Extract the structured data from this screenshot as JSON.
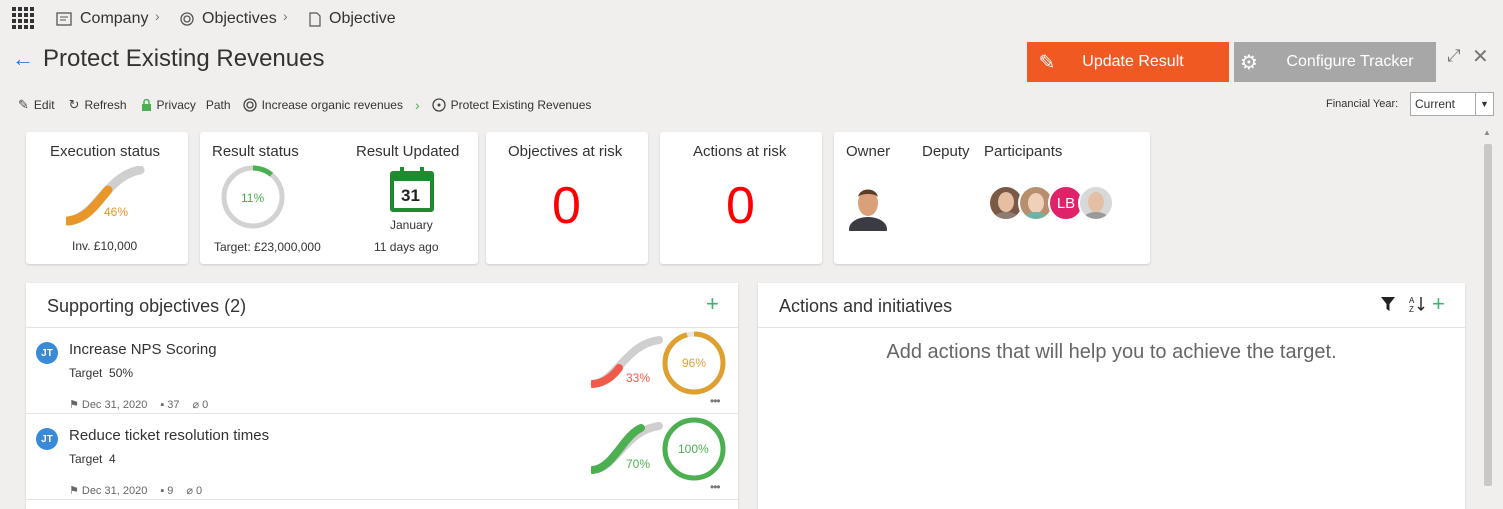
{
  "breadcrumb": {
    "items": [
      {
        "label": "Company",
        "icon": "company-icon"
      },
      {
        "label": "Objectives",
        "icon": "target-icon"
      },
      {
        "label": "Objective",
        "icon": "document-icon"
      }
    ]
  },
  "page": {
    "title": "Protect Existing Revenues"
  },
  "actions": {
    "update_label": "Update Result",
    "configure_label": "Configure Tracker"
  },
  "toolbar": {
    "edit_label": "Edit",
    "refresh_label": "Refresh",
    "privacy_label": "Privacy",
    "path_label": "Path",
    "path_items": [
      "Increase organic revenues",
      "Protect Existing Revenues"
    ]
  },
  "financial_year": {
    "label": "Financial Year:",
    "value": "Current"
  },
  "cards": {
    "execution": {
      "label": "Execution status",
      "percent": "46%",
      "percent_value": 46,
      "footer": "Inv. £10,000",
      "color": "#e8962a"
    },
    "result": {
      "label": "Result status",
      "percent": "11%",
      "percent_value": 11,
      "footer": "Target: £23,000,000",
      "color": "#4caf50"
    },
    "updated": {
      "label": "Result Updated",
      "day": "31",
      "month": "January",
      "ago": "11 days ago"
    },
    "objectives_risk": {
      "label": "Objectives at risk",
      "value": "0"
    },
    "actions_risk": {
      "label": "Actions at risk",
      "value": "0"
    },
    "people": {
      "owner_label": "Owner",
      "deputy_label": "Deputy",
      "participants_label": "Participants",
      "participant_initials": "LB"
    }
  },
  "supporting": {
    "title": "Supporting objectives (2)",
    "rows": [
      {
        "initials": "JT",
        "title": "Increase NPS Scoring",
        "target_label": "Target",
        "target_value": "50%",
        "date": "Dec 31, 2020",
        "comments": "37",
        "attachments": "0",
        "execution_pct": "33%",
        "execution_value": 33,
        "execution_color": "#f05a4a",
        "result_pct": "96%",
        "result_value": 96,
        "result_color": "#e0a030"
      },
      {
        "initials": "JT",
        "title": "Reduce ticket resolution times",
        "target_label": "Target",
        "target_value": "4",
        "date": "Dec 31, 2020",
        "comments": "9",
        "attachments": "0",
        "execution_pct": "70%",
        "execution_value": 70,
        "execution_color": "#4caf50",
        "result_pct": "100%",
        "result_value": 100,
        "result_color": "#4caf50"
      }
    ]
  },
  "actions_panel": {
    "title": "Actions and initiatives",
    "empty_text": "Add actions that will help you to achieve the target."
  }
}
